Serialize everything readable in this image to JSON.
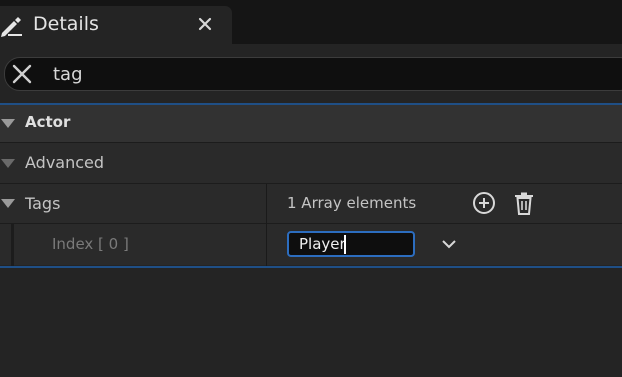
{
  "tab": {
    "title": "Details",
    "icon": "edit-pencil-icon",
    "close_icon": "close-icon"
  },
  "search": {
    "value": "tag",
    "clear_icon": "close-icon"
  },
  "sections": {
    "actor": "Actor",
    "advanced": "Advanced"
  },
  "tags": {
    "label": "Tags",
    "array_summary": "1 Array elements",
    "add_icon": "plus-circle-icon",
    "delete_icon": "trash-icon",
    "element": {
      "label": "Index [ 0 ]",
      "value": "Player",
      "dropdown_icon": "chevron-down-icon"
    }
  },
  "colors": {
    "accent": "#2c6dbf",
    "selection_line": "#1f4f86",
    "background": "#242424"
  }
}
